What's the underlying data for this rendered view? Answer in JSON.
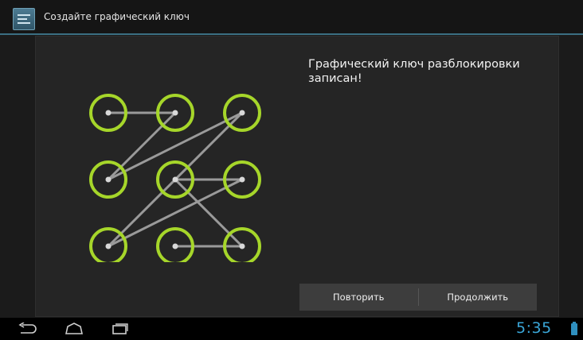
{
  "action_bar": {
    "title": "Создайте графический ключ",
    "icon": "settings-sliders-icon"
  },
  "message": "Графический ключ разблокировки записан!",
  "pattern": {
    "ring_color": "#a6d62a",
    "line_color": "#9a9a9a",
    "sequence": [
      1,
      2,
      4,
      3,
      7,
      6,
      5,
      9,
      8
    ],
    "dot_labels": [
      "1",
      "2",
      "3",
      "4",
      "5",
      "6",
      "7",
      "8",
      "9"
    ]
  },
  "buttons": {
    "retry": "Повторить",
    "continue": "Продолжить"
  },
  "nav": {
    "back_icon": "back-icon",
    "home_icon": "home-icon",
    "recents_icon": "recent-apps-icon"
  },
  "status": {
    "time": "5:35",
    "battery_icon": "battery-icon",
    "accent": "#3aa6d8"
  }
}
